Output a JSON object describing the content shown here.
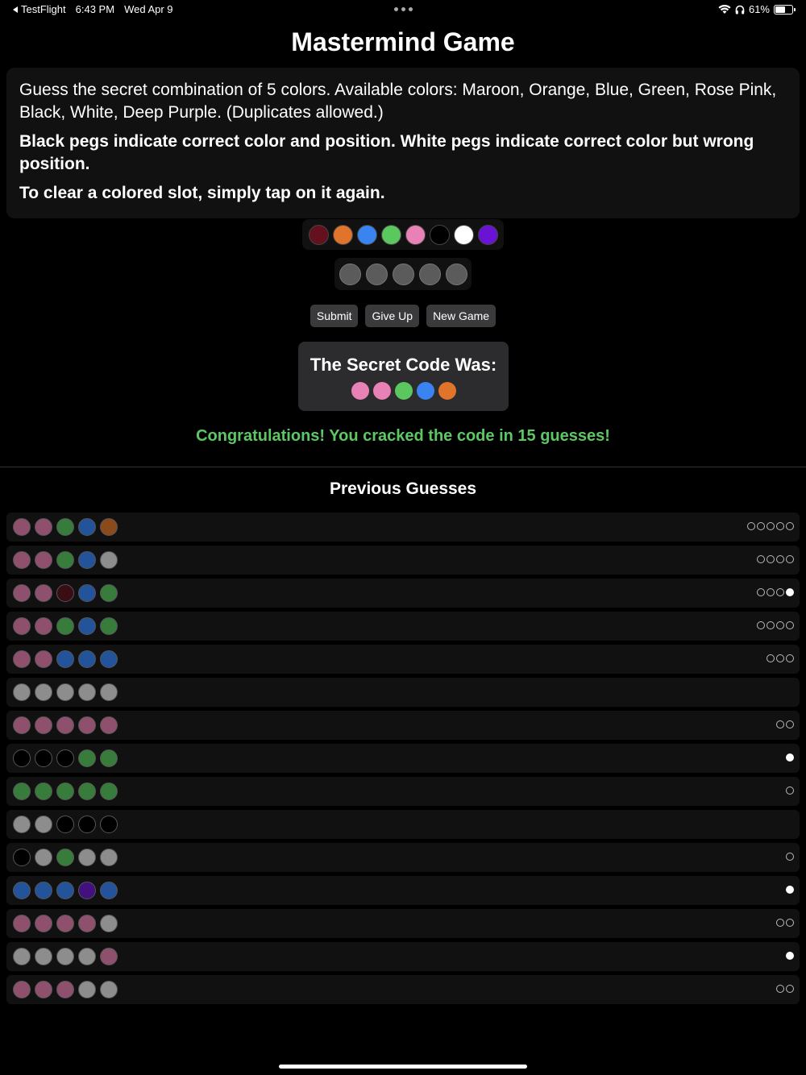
{
  "status_bar": {
    "back_app": "TestFlight",
    "time": "6:43 PM",
    "date": "Wed Apr 9",
    "battery": "61%",
    "battery_level": 0.61
  },
  "title": "Mastermind Game",
  "instructions": {
    "line1": "Guess the secret combination of 5 colors. Available colors: Maroon, Orange, Blue, Green, Rose Pink, Black, White, Deep Purple. (Duplicates allowed.)",
    "line2": "Black pegs indicate correct color and position. White pegs indicate correct color but wrong position.",
    "line3": "To clear a colored slot, simply tap on it again."
  },
  "colors": {
    "maroon": "#64101e",
    "orange": "#e0742a",
    "blue": "#3a84f2",
    "green": "#5ac85f",
    "rose": "#e882b6",
    "black": "#000000",
    "white": "#ffffff",
    "purple": "#6a12d6",
    "empty": "#5b5b5b"
  },
  "dim_colors": {
    "maroon": "#3a0c13",
    "orange": "#8a4a1c",
    "blue": "#23539a",
    "green": "#377c3b",
    "rose": "#8f506e",
    "black": "#000000",
    "white": "#8d8d8d",
    "purple": "#42107f"
  },
  "palette": [
    "maroon",
    "orange",
    "blue",
    "green",
    "rose",
    "black",
    "white",
    "purple"
  ],
  "buttons": {
    "submit": "Submit",
    "give_up": "Give Up",
    "new_game": "New Game"
  },
  "secret": {
    "title": "The Secret Code Was:",
    "code": [
      "rose",
      "rose",
      "green",
      "blue",
      "orange"
    ]
  },
  "result_message": "Congratulations! You cracked the code in 15 guesses!",
  "history_title": "Previous Guesses",
  "guesses": [
    {
      "pegs": [
        "rose",
        "rose",
        "green",
        "blue",
        "orange"
      ],
      "black": 0,
      "white": 5
    },
    {
      "pegs": [
        "rose",
        "rose",
        "green",
        "blue",
        "white"
      ],
      "black": 0,
      "white": 4
    },
    {
      "pegs": [
        "rose",
        "rose",
        "maroon",
        "blue",
        "green"
      ],
      "black": 1,
      "white": 3
    },
    {
      "pegs": [
        "rose",
        "rose",
        "green",
        "blue",
        "green"
      ],
      "black": 0,
      "white": 4
    },
    {
      "pegs": [
        "rose",
        "rose",
        "blue",
        "blue",
        "blue"
      ],
      "black": 0,
      "white": 3
    },
    {
      "pegs": [
        "white",
        "white",
        "white",
        "white",
        "white"
      ],
      "black": 0,
      "white": 0
    },
    {
      "pegs": [
        "rose",
        "rose",
        "rose",
        "rose",
        "rose"
      ],
      "black": 0,
      "white": 2
    },
    {
      "pegs": [
        "black",
        "black",
        "black",
        "green",
        "green"
      ],
      "black": 1,
      "white": 0
    },
    {
      "pegs": [
        "green",
        "green",
        "green",
        "green",
        "green"
      ],
      "black": 0,
      "white": 1
    },
    {
      "pegs": [
        "white",
        "white",
        "black",
        "black",
        "black"
      ],
      "black": 0,
      "white": 0
    },
    {
      "pegs": [
        "black",
        "white",
        "green",
        "white",
        "white"
      ],
      "black": 0,
      "white": 1
    },
    {
      "pegs": [
        "blue",
        "blue",
        "blue",
        "purple",
        "blue"
      ],
      "black": 1,
      "white": 0
    },
    {
      "pegs": [
        "rose",
        "rose",
        "rose",
        "rose",
        "white"
      ],
      "black": 0,
      "white": 2
    },
    {
      "pegs": [
        "white",
        "white",
        "white",
        "white",
        "rose"
      ],
      "black": 1,
      "white": 0
    },
    {
      "pegs": [
        "rose",
        "rose",
        "rose",
        "white",
        "white"
      ],
      "black": 0,
      "white": 2
    }
  ]
}
